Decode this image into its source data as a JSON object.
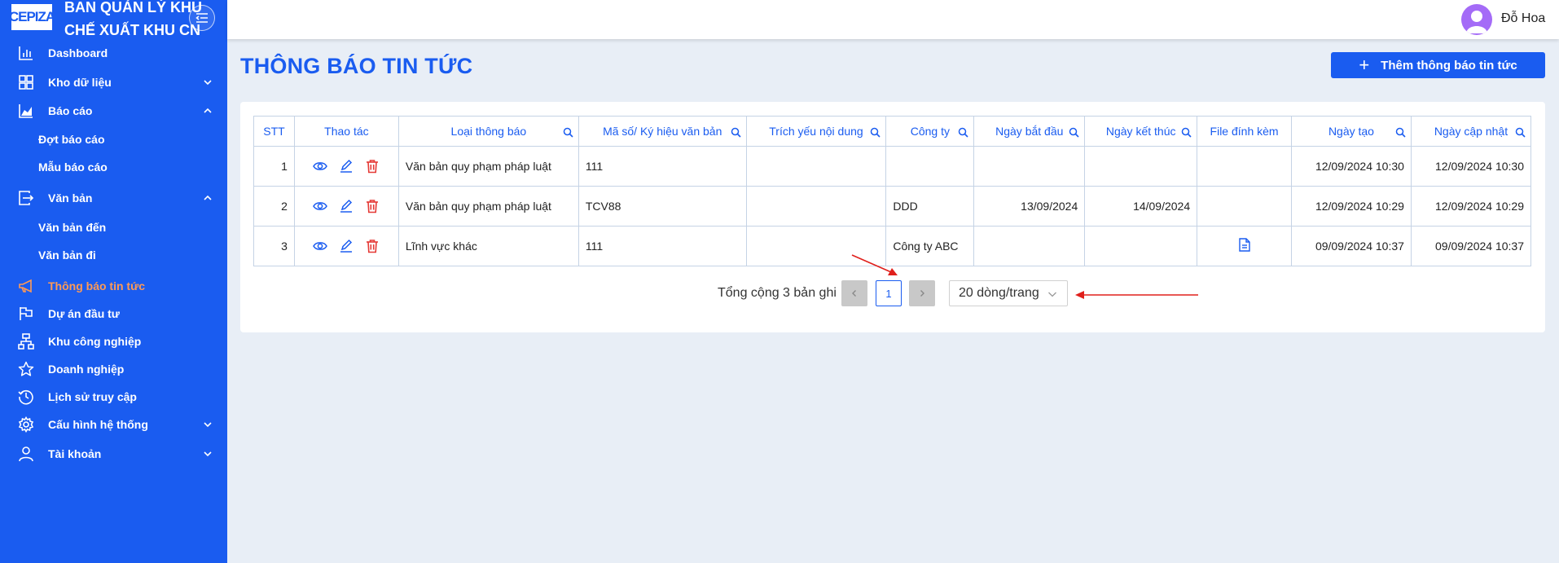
{
  "brand": {
    "logo_text": "CEPIZA",
    "title_line1": "BAN QUẢN LÝ KHU",
    "title_line2": "CHẾ XUẤT KHU CN"
  },
  "sidebar": {
    "items": [
      {
        "label": "Dashboard",
        "icon": "bar-chart-icon"
      },
      {
        "label": "Kho dữ liệu",
        "icon": "grid-icon",
        "expand": "collapsed"
      },
      {
        "label": "Báo cáo",
        "icon": "area-chart-icon",
        "expand": "expanded"
      },
      {
        "label": "Đợt báo cáo"
      },
      {
        "label": "Mẫu báo cáo"
      },
      {
        "label": "Văn bản",
        "icon": "document-export-icon",
        "expand": "expanded"
      },
      {
        "label": "Văn bản đến"
      },
      {
        "label": "Văn bản đi"
      },
      {
        "label": "Thông báo tin tức",
        "icon": "megaphone-icon",
        "active": true
      },
      {
        "label": "Dự án đầu tư",
        "icon": "flag-icon"
      },
      {
        "label": "Khu công nghiệp",
        "icon": "hierarchy-icon"
      },
      {
        "label": "Doanh nghiệp",
        "icon": "star-icon"
      },
      {
        "label": "Lịch sử truy cập",
        "icon": "clock-icon"
      },
      {
        "label": "Cấu hình hệ thống",
        "icon": "gear-icon",
        "expand": "collapsed"
      },
      {
        "label": "Tài khoản",
        "icon": "user-icon",
        "expand": "collapsed"
      }
    ]
  },
  "header": {
    "user_name": "Đỗ Hoa"
  },
  "page": {
    "title": "THÔNG BÁO TIN TỨC",
    "add_button": "Thêm thông báo tin tức"
  },
  "table": {
    "columns": [
      "STT",
      "Thao tác",
      "Loại thông báo",
      "Mã số/ Ký hiệu văn bản",
      "Trích yếu nội dung",
      "Công ty",
      "Ngày bắt đầu",
      "Ngày kết thúc",
      "File đính kèm",
      "Ngày tạo",
      "Ngày cập nhật"
    ],
    "rows": [
      {
        "stt": "1",
        "type": "Văn bản quy phạm pháp luật",
        "code": "111",
        "summary": "",
        "company": "",
        "start": "",
        "end": "",
        "file": false,
        "created": "12/09/2024 10:30",
        "updated": "12/09/2024 10:30"
      },
      {
        "stt": "2",
        "type": "Văn bản quy phạm pháp luật",
        "code": "TCV88",
        "summary": "",
        "company": "DDD",
        "start": "13/09/2024",
        "end": "14/09/2024",
        "file": false,
        "created": "12/09/2024 10:29",
        "updated": "12/09/2024 10:29"
      },
      {
        "stt": "3",
        "type": "Lĩnh vực khác",
        "code": "111",
        "summary": "",
        "company": "Công ty ABC",
        "start": "",
        "end": "",
        "file": true,
        "created": "09/09/2024 10:37",
        "updated": "09/09/2024 10:37"
      }
    ]
  },
  "pagination": {
    "total_text": "Tổng cộng 3 bản ghi",
    "current_page": "1",
    "page_size": "20 dòng/trang"
  },
  "colors": {
    "primary": "#1a5cf0",
    "active_menu": "#ff9a55",
    "delete": "#e53935",
    "annotation_arrow": "#e0201c"
  }
}
